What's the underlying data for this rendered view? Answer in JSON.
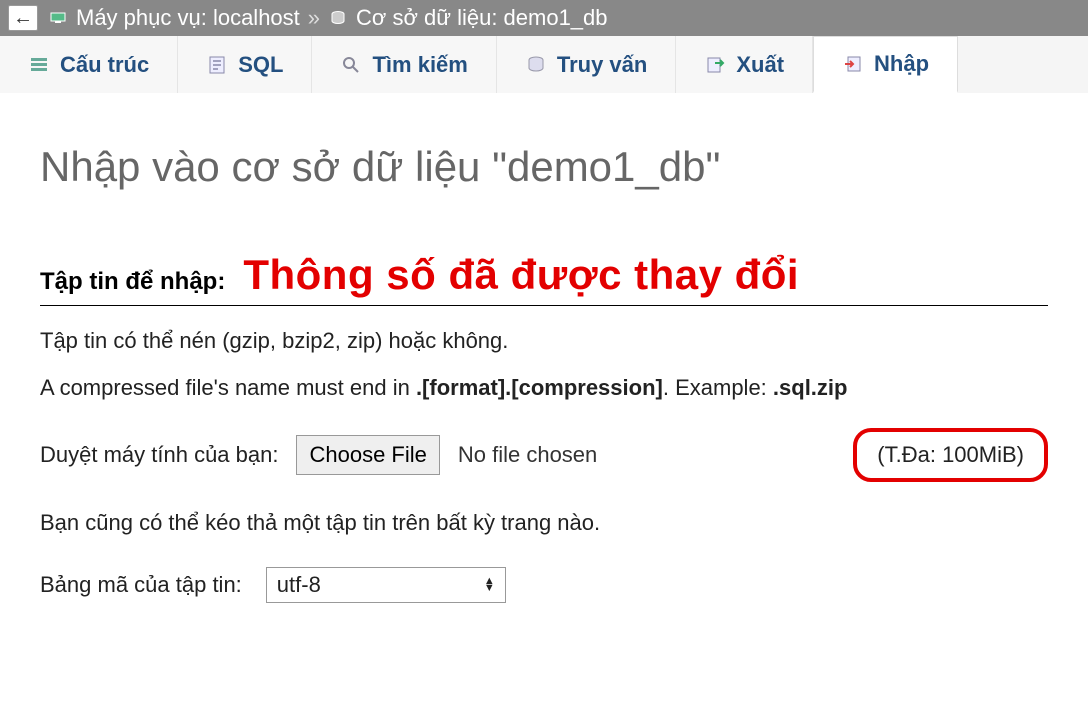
{
  "topbar": {
    "back_icon": "←",
    "server_label": "Máy phục vụ: localhost",
    "separator": "»",
    "database_label": "Cơ sở dữ liệu: demo1_db"
  },
  "tabs": [
    {
      "id": "structure",
      "label": "Cấu trúc",
      "icon": "structure-icon"
    },
    {
      "id": "sql",
      "label": "SQL",
      "icon": "sql-icon"
    },
    {
      "id": "search",
      "label": "Tìm kiếm",
      "icon": "search-icon"
    },
    {
      "id": "query",
      "label": "Truy vấn",
      "icon": "query-icon"
    },
    {
      "id": "export",
      "label": "Xuất",
      "icon": "export-icon"
    },
    {
      "id": "import",
      "label": "Nhập",
      "icon": "import-icon",
      "active": true
    }
  ],
  "main": {
    "title": "Nhập vào cơ sở dữ liệu \"demo1_db\"",
    "section_label": "Tập tin để nhập:",
    "overlay": "Thông số đã được thay đổi",
    "line1": "Tập tin có thể nén (gzip, bzip2, zip) hoặc không.",
    "line2_a": "A compressed file's name must end in ",
    "line2_b": ".[format].[compression]",
    "line2_c": ". Example: ",
    "line2_d": ".sql.zip",
    "browse_label": "Duyệt máy tính của bạn:",
    "choose_file": "Choose File",
    "no_file": "No file chosen",
    "max_size": "(T.Đa: 100MiB)",
    "drag_hint": "Bạn cũng có thể kéo thả một tập tin trên bất kỳ trang nào.",
    "charset_label": "Bảng mã của tập tin:",
    "charset_value": "utf-8"
  }
}
